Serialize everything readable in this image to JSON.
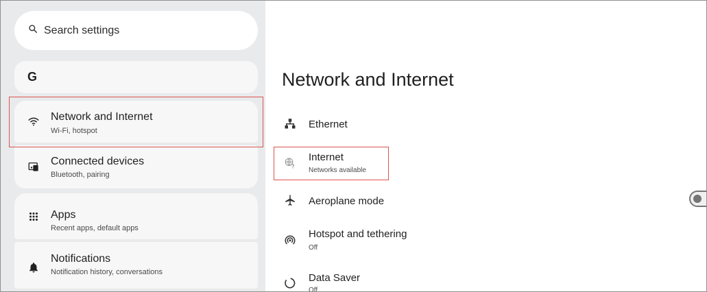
{
  "search": {
    "placeholder": "Search settings",
    "icon": "search-icon"
  },
  "account": {
    "logo": "G"
  },
  "sidebar": {
    "items": [
      {
        "title": "Network and Internet",
        "subtitle": "Wi-Fi, hotspot",
        "icon": "wifi-icon",
        "selected": true
      },
      {
        "title": "Connected devices",
        "subtitle": "Bluetooth, pairing",
        "icon": "devices-icon"
      },
      {
        "title": "Apps",
        "subtitle": "Recent apps, default apps",
        "icon": "apps-grid-icon"
      },
      {
        "title": "Notifications",
        "subtitle": "Notification history, conversations",
        "icon": "bell-icon"
      }
    ]
  },
  "main": {
    "title": "Network and Internet",
    "rows": [
      {
        "title": "Ethernet",
        "subtitle": "",
        "icon": "ethernet-icon"
      },
      {
        "title": "Internet",
        "subtitle": "Networks available",
        "icon": "globe-question-icon"
      },
      {
        "title": "Aeroplane mode",
        "subtitle": "",
        "icon": "airplane-icon",
        "toggle": false
      },
      {
        "title": "Hotspot and tethering",
        "subtitle": "Off",
        "icon": "hotspot-icon"
      },
      {
        "title": "Data Saver",
        "subtitle": "Off",
        "icon": "data-saver-icon"
      }
    ]
  },
  "colors": {
    "sidebar_bg": "#e9eaeb",
    "card_bg": "#f7f7f8",
    "highlight_border": "#d9534f"
  }
}
